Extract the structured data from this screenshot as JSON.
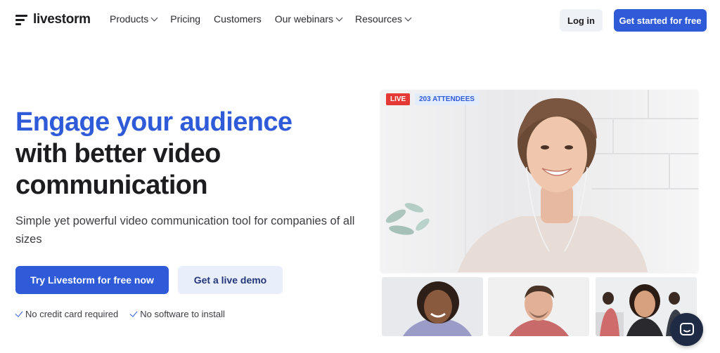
{
  "nav": {
    "logo": "livestorm",
    "links": [
      {
        "label": "Products",
        "dropdown": true
      },
      {
        "label": "Pricing",
        "dropdown": false
      },
      {
        "label": "Customers",
        "dropdown": false
      },
      {
        "label": "Our webinars",
        "dropdown": true
      },
      {
        "label": "Resources",
        "dropdown": true
      }
    ],
    "login": "Log in",
    "cta": "Get started for free"
  },
  "hero": {
    "headline_blue": "Engage your audience",
    "headline_line2": "with better video",
    "headline_line3": "communication",
    "subtitle": "Simple yet powerful video communication tool for companies of all sizes",
    "primary_button": "Try Livestorm for free now",
    "secondary_button": "Get a live demo",
    "checks": [
      "No credit card required",
      "No software to install"
    ]
  },
  "video": {
    "live_badge": "LIVE",
    "attendees_badge": "203 ATTENDEES"
  },
  "colors": {
    "brand_blue": "#2f5bd9",
    "live_red": "#e53935",
    "chat_navy": "#1f2a44"
  },
  "icons": [
    "logo-mark-icon",
    "chevron-down-icon",
    "check-icon",
    "chat-icon"
  ]
}
